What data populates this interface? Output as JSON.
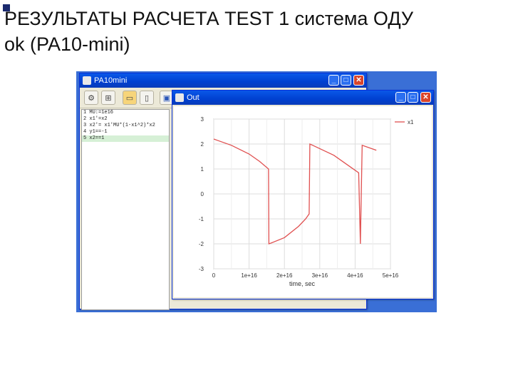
{
  "slide": {
    "title_line1": "РЕЗУЛЬТАТЫ РАСЧЕТА TEST 1 система ОДУ",
    "title_line2": "ok (PA10-mini)"
  },
  "main_window": {
    "title": "PA10mini",
    "controls": {
      "minimize": "_",
      "maximize": "□",
      "close": "✕"
    },
    "editor_lines": [
      "1 MU:=1e16",
      "2 x1'=x2",
      "3 x2'= x1'MU*(1-x1^2)*x2",
      "4 y1==-1",
      "5 x2==1"
    ],
    "selected_line_index": 4
  },
  "plot_window": {
    "title": "Out",
    "controls": {
      "minimize": "_",
      "maximize": "□",
      "close": "✕"
    }
  },
  "chart_data": {
    "type": "line",
    "xlabel": "time, sec",
    "ylabel": "",
    "x_tick_labels": [
      "0",
      "1e+16",
      "2e+16",
      "3e+16",
      "4e+16",
      "5e+16"
    ],
    "y_tick_labels": [
      "3",
      "2",
      "1",
      "0",
      "-1",
      "-2",
      "-3"
    ],
    "x_ticks": [
      0,
      1e+16,
      2e+16,
      3e+16,
      4e+16,
      5e+16
    ],
    "y_ticks": [
      3,
      2,
      1,
      0,
      -1,
      -2,
      -3
    ],
    "xlim": [
      0,
      5e+16
    ],
    "ylim": [
      -3,
      3
    ],
    "grid": true,
    "legend_position": "top-right",
    "series": [
      {
        "name": "x1",
        "color": "#e05050",
        "x": [
          0,
          1000000000000000.0,
          5000000000000000.0,
          1e+16,
          1.3e+16,
          1.55e+16,
          1.56e+16,
          1.6e+16,
          2e+16,
          2.4e+16,
          2.6e+16,
          2.7e+16,
          2.72e+16,
          2.8e+16,
          3.4e+16,
          3.9e+16,
          4.1e+16,
          4.15e+16,
          4.2e+16,
          4.6e+16
        ],
        "y": [
          2.2,
          2.15,
          1.95,
          1.6,
          1.3,
          1.0,
          -2.0,
          -1.98,
          -1.75,
          -1.3,
          -1.0,
          -0.8,
          2.0,
          1.95,
          1.55,
          1.05,
          0.85,
          -2.0,
          1.95,
          1.75
        ]
      }
    ]
  },
  "colors": {
    "desktop_blue": "#3a6fd6",
    "titlebar_blue": "#0a58e8",
    "window_gray": "#ece9d8",
    "series_red": "#e05050",
    "grid_gray": "#dddddd"
  },
  "toolbar_icons": [
    "gear-icon",
    "hierarchy-icon",
    "open-folder-icon",
    "new-file-icon",
    "save-icon"
  ]
}
